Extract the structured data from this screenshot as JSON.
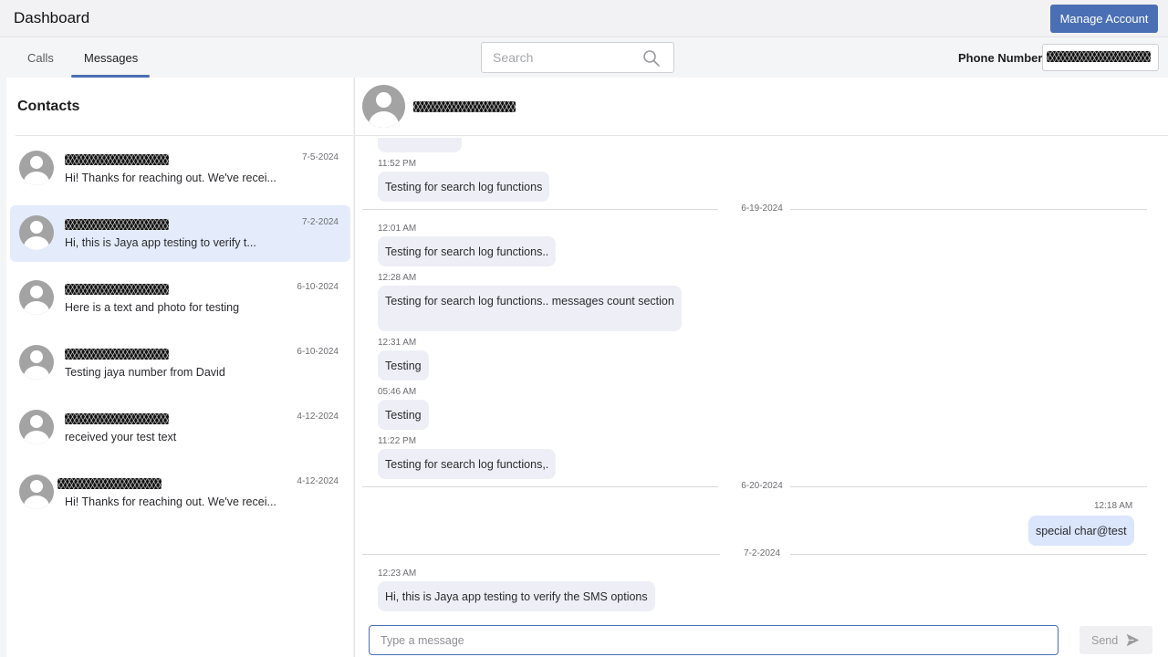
{
  "app": {
    "title": "Dashboard",
    "manage_account": "Manage Account"
  },
  "tabs": [
    {
      "label": "Calls"
    },
    {
      "label": "Messages",
      "active": true
    }
  ],
  "search": {
    "placeholder": "Search"
  },
  "phone": {
    "label": "Phone Number",
    "value": "[redacted]"
  },
  "contacts": {
    "title": "Contacts",
    "items": [
      {
        "date": "7-5-2024",
        "preview": "Hi! Thanks for reaching out. We've recei...",
        "selected": false
      },
      {
        "date": "7-2-2024",
        "preview": "Hi, this is Jaya app testing to verify t...",
        "selected": true
      },
      {
        "date": "6-10-2024",
        "preview": "Here is a text and photo for testing",
        "selected": false
      },
      {
        "date": "6-10-2024",
        "preview": "Testing jaya number from David",
        "selected": false
      },
      {
        "date": "4-12-2024",
        "preview": "received your test text",
        "selected": false
      },
      {
        "date": "4-12-2024",
        "preview": "Hi! Thanks for reaching out. We've recei...",
        "selected": false
      }
    ]
  },
  "chat": {
    "messages": [
      {
        "time": "11:52 PM",
        "text": "Testing for search log functions"
      },
      {
        "date_separator": "6-19-2024"
      },
      {
        "time": "12:01 AM",
        "text": "Testing for search log functions.."
      },
      {
        "time": "12:28 AM",
        "text": "Testing for search log functions.. messages count section"
      },
      {
        "time": "12:31 AM",
        "text": "Testing"
      },
      {
        "time": "05:46 AM",
        "text": "Testing"
      },
      {
        "time": "11:22 PM",
        "text": "Testing for search log functions,."
      },
      {
        "date_separator": "6-20-2024"
      },
      {
        "time": "12:18 AM",
        "text": "special char@test",
        "outgoing": true
      },
      {
        "date_separator": "7-2-2024"
      },
      {
        "time": "12:23 AM",
        "text": "Hi, this is Jaya app testing to verify the SMS options"
      }
    ],
    "composer": {
      "placeholder": "Type a message",
      "send_label": "Send"
    }
  },
  "colors": {
    "accent": "#4a6fb4",
    "selected_contact": "#e4ecfb",
    "incoming_bubble": "#eeeff6",
    "outgoing_bubble": "#dbe5fb"
  },
  "icons": {
    "search": "search-icon",
    "send": "send-icon",
    "avatar": "avatar-icon"
  }
}
